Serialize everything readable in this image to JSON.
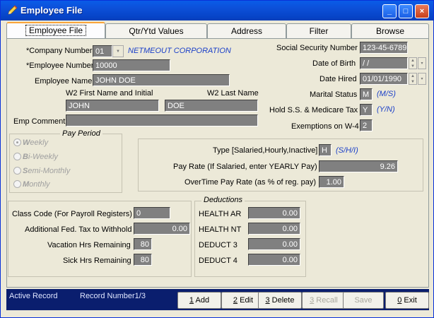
{
  "window": {
    "title": "Employee File",
    "minimize": "_",
    "maximize": "□",
    "close": "×"
  },
  "tabs": [
    {
      "label": "Employee File"
    },
    {
      "label": "Qtr/Ytd Values"
    },
    {
      "label": "Address"
    },
    {
      "label": "Filter"
    },
    {
      "label": "Browse"
    }
  ],
  "company": {
    "label": "*Company Number",
    "value": "01",
    "name": "NETMEOUT CORPORATION"
  },
  "employee_number": {
    "label": "*Employee Number",
    "value": "10000"
  },
  "employee_name": {
    "label": "Employee Name",
    "value": "JOHN DOE"
  },
  "w2_first": {
    "label": "W2 First Name and Initial",
    "value": "JOHN"
  },
  "w2_last": {
    "label": "W2 Last Name",
    "value": "DOE"
  },
  "emp_comment": {
    "label": "Emp Comment",
    "value": ""
  },
  "ssn": {
    "label": "Social Security Number",
    "value": "123-45-6789"
  },
  "dob": {
    "label": "Date of Birth",
    "value": " / /"
  },
  "hired": {
    "label": "Date Hired",
    "value": "01/01/1990"
  },
  "marital": {
    "label": "Marital Status",
    "value": "M",
    "hint": "(M/S)"
  },
  "hold_ss": {
    "label": "Hold S.S. & Medicare Tax",
    "value": "Y",
    "hint": "(Y/N)"
  },
  "exemptions": {
    "label": "Exemptions on W-4",
    "value": "2"
  },
  "pay_period": {
    "title": "Pay Period",
    "options": [
      {
        "key": "W",
        "rest": "eekly",
        "selected": true
      },
      {
        "key": "B",
        "rest": "i-Weekly",
        "selected": false
      },
      {
        "key": "S",
        "rest": "emi-Monthly",
        "selected": false
      },
      {
        "key": "M",
        "rest": "onthly",
        "selected": false
      }
    ]
  },
  "pay_type": {
    "label": "Type [Salaried,Hourly,Inactive]",
    "value": "H",
    "hint": "(S/H/I)"
  },
  "pay_rate": {
    "label": "Pay Rate (If Salaried, enter YEARLY Pay)",
    "value": "9.26"
  },
  "overtime": {
    "label": "OverTime Pay Rate (as % of reg. pay)",
    "value": "1.00"
  },
  "class_code": {
    "label": "Class Code (For Payroll Registers)",
    "value": "0"
  },
  "addl_fed": {
    "label": "Additional Fed. Tax to Withhold",
    "value": "0.00"
  },
  "vacation": {
    "label": "Vacation Hrs Remaining",
    "value": "80"
  },
  "sick": {
    "label": "Sick Hrs Remaining",
    "value": "80"
  },
  "deductions": {
    "title": "Deductions",
    "items": [
      {
        "label": "HEALTH AR",
        "value": "0.00"
      },
      {
        "label": "HEALTH NT",
        "value": "0.00"
      },
      {
        "label": "DEDUCT 3",
        "value": "0.00"
      },
      {
        "label": "DEDUCT 4",
        "value": "0.00"
      }
    ]
  },
  "status": {
    "active": "Active Record",
    "record": "Record Number1/3"
  },
  "buttons": {
    "add": {
      "key": "1",
      "rest": " Add"
    },
    "edit": {
      "key": "2",
      "rest": " Edit"
    },
    "delete": {
      "key": "3",
      "rest": " Delete"
    },
    "recall": {
      "key": "3",
      "rest": " Recall"
    },
    "save": {
      "label": "Save"
    },
    "exit": {
      "key": "0",
      "rest": " Exit"
    }
  }
}
